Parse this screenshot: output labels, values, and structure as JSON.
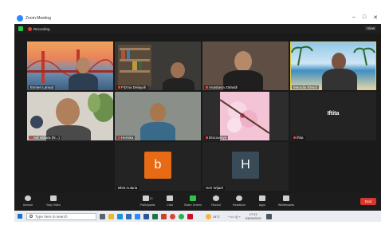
{
  "window": {
    "title": "Zoom Meeting",
    "controls": [
      "–",
      "□",
      "✕"
    ]
  },
  "status": {
    "recording_label": "Recording",
    "view_label": "View"
  },
  "participants": [
    {
      "name": "Esmeri Lamud"
    },
    {
      "name": "Fitzma Delayah"
    },
    {
      "name": "Anastasia Zafaddi"
    },
    {
      "name": "Maradia Ebsidi"
    },
    {
      "name": "Adi Wiliara (N...)"
    },
    {
      "name": "Heriska"
    },
    {
      "name": "Discoveryy"
    },
    {
      "name": "Iftita",
      "big_label": "Iftita"
    },
    {
      "name": "Bhrit Aularia",
      "avatar_letter": "b"
    },
    {
      "name": "Heri Wijadi",
      "avatar_letter": "H"
    }
  ],
  "toolbar": {
    "items": [
      {
        "label": "Unmute",
        "icon": "microphone-icon"
      },
      {
        "label": "Stop Video",
        "icon": "video-camera-icon"
      },
      {
        "label": "Participants",
        "icon": "participants-icon",
        "count": "10"
      },
      {
        "label": "Chat",
        "icon": "chat-icon"
      },
      {
        "label": "Share Screen",
        "icon": "share-screen-icon"
      },
      {
        "label": "Record",
        "icon": "record-icon"
      },
      {
        "label": "Reactions",
        "icon": "reactions-icon"
      },
      {
        "label": "Apps",
        "icon": "apps-icon"
      },
      {
        "label": "Whiteboards",
        "icon": "whiteboard-icon"
      }
    ],
    "end_label": "End"
  },
  "taskbar": {
    "search_placeholder": "Type here to search",
    "weather": "24°C",
    "time": "17:21",
    "date": "03/09/2022"
  },
  "colors": {
    "accent": "#2d8cff",
    "share_green": "#2ec24a",
    "end_red": "#d9362f",
    "active_speaker": "#e8d04a"
  }
}
